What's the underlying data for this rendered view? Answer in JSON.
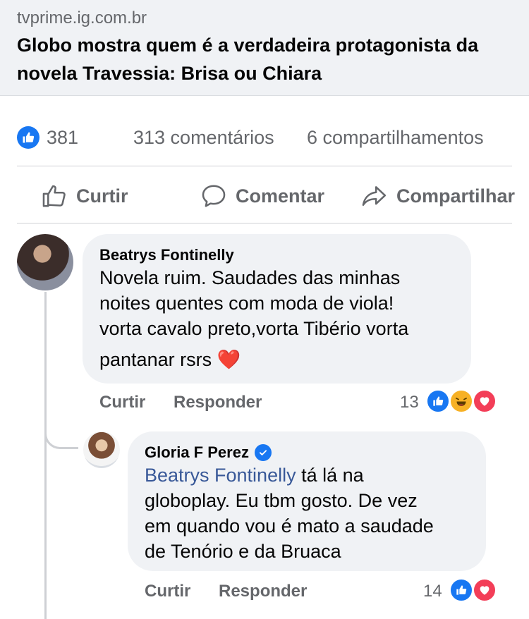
{
  "link_preview": {
    "domain": "tvprime.ig.com.br",
    "title": "Globo mostra quem é a verdadeira protagonista da novela Travessia: Brisa ou Chiara"
  },
  "stats": {
    "likes": "381",
    "comments": "313 comentários",
    "shares": "6 compartilhamentos"
  },
  "actions": {
    "like": "Curtir",
    "comment": "Comentar",
    "share": "Compartilhar"
  },
  "comments": [
    {
      "author": "Beatrys Fontinelly",
      "lines": [
        "Novela ruim. Saudades das minhas",
        "noites quentes com moda de viola!",
        "vorta cavalo preto,vorta Tibério vorta",
        "pantanar rsrs ❤️"
      ],
      "like_label": "Curtir",
      "reply_label": "Responder",
      "reaction_count": "13",
      "reactions": [
        "like",
        "haha",
        "love"
      ]
    },
    {
      "author": "Gloria F Perez",
      "verified": true,
      "mention": "Beatrys Fontinelly",
      "line1_rest": " tá lá na",
      "lines": [
        "globoplay. Eu tbm gosto. De vez",
        "em quando vou é mato a saudade",
        "de Tenório e da Bruaca"
      ],
      "like_label": "Curtir",
      "reply_label": "Responder",
      "reaction_count": "14",
      "reactions": [
        "like",
        "love"
      ]
    }
  ],
  "colors": {
    "like_blue": "#1877f2",
    "love_red": "#f33e58",
    "haha_yellow": "#f7b125",
    "bubble_bg": "#f0f2f5",
    "muted": "#65676b"
  }
}
